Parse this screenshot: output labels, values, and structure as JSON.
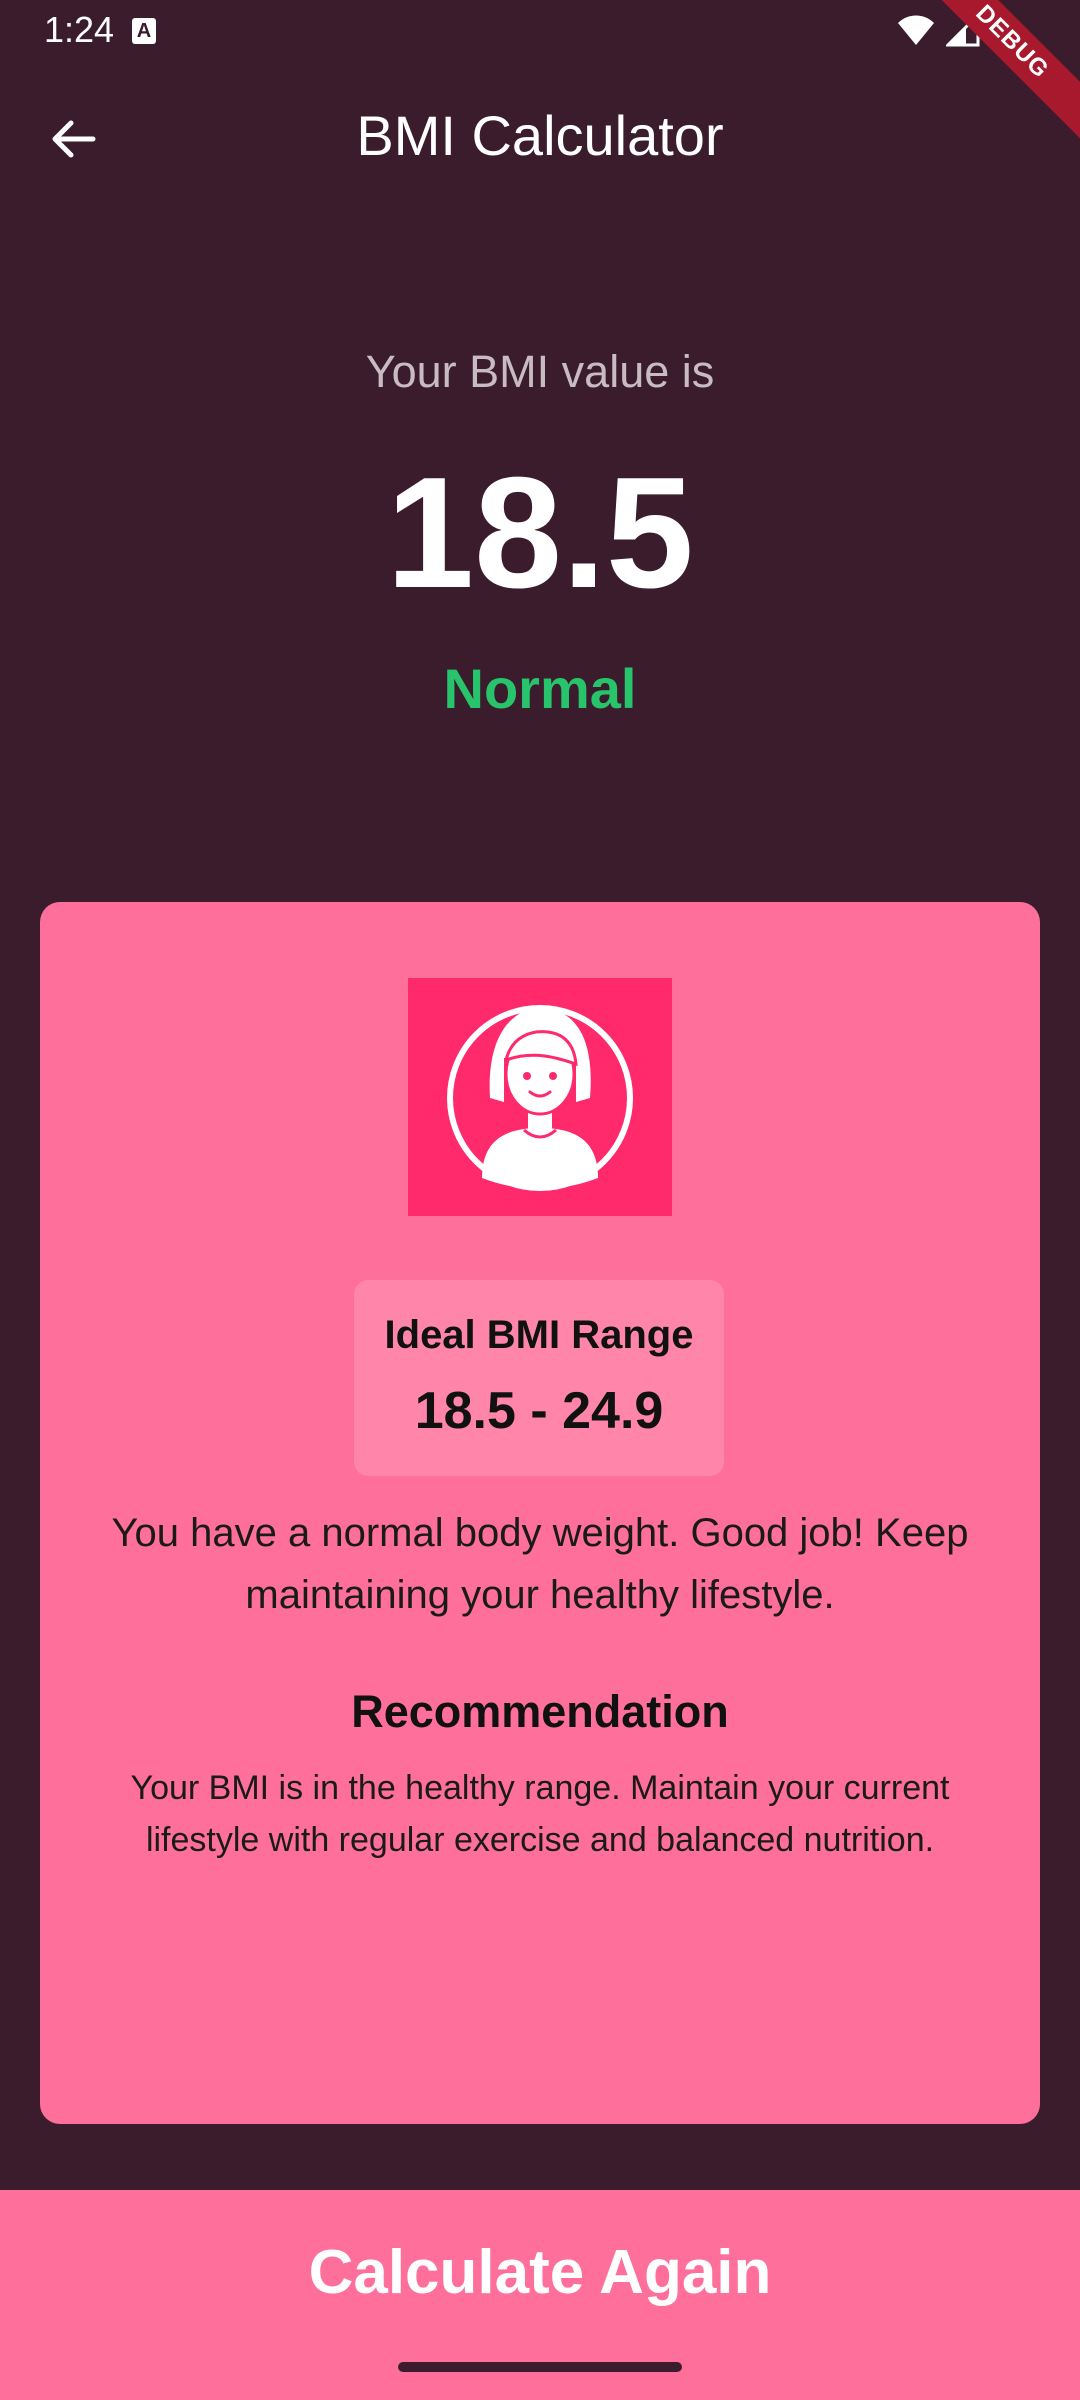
{
  "status_bar": {
    "time": "1:24",
    "notification_letter": "A",
    "icons": [
      "wifi-icon",
      "signal-icon",
      "battery-icon"
    ]
  },
  "debug_banner": "DEBUG",
  "app_bar": {
    "title": "BMI Calculator",
    "back_icon": "arrow-left-icon"
  },
  "result": {
    "label": "Your BMI value is",
    "value": "18.5",
    "category": "Normal",
    "category_color": "#27c46c"
  },
  "card": {
    "avatar_icon": "woman-avatar-icon",
    "ideal_range_title": "Ideal BMI Range",
    "ideal_range_value": "18.5 - 24.9",
    "interpretation": "You have a normal body weight. Good job! Keep maintaining your healthy lifestyle.",
    "recommendation_title": "Recommendation",
    "recommendation_text": "Your BMI is in the healthy range. Maintain your current lifestyle with regular exercise and balanced nutrition."
  },
  "button": {
    "calculate_again": "Calculate Again"
  },
  "colors": {
    "background": "#3b1c2c",
    "accent": "#ff6f9b",
    "avatar_bg": "#ff2a6b",
    "normal_green": "#27c46c"
  }
}
